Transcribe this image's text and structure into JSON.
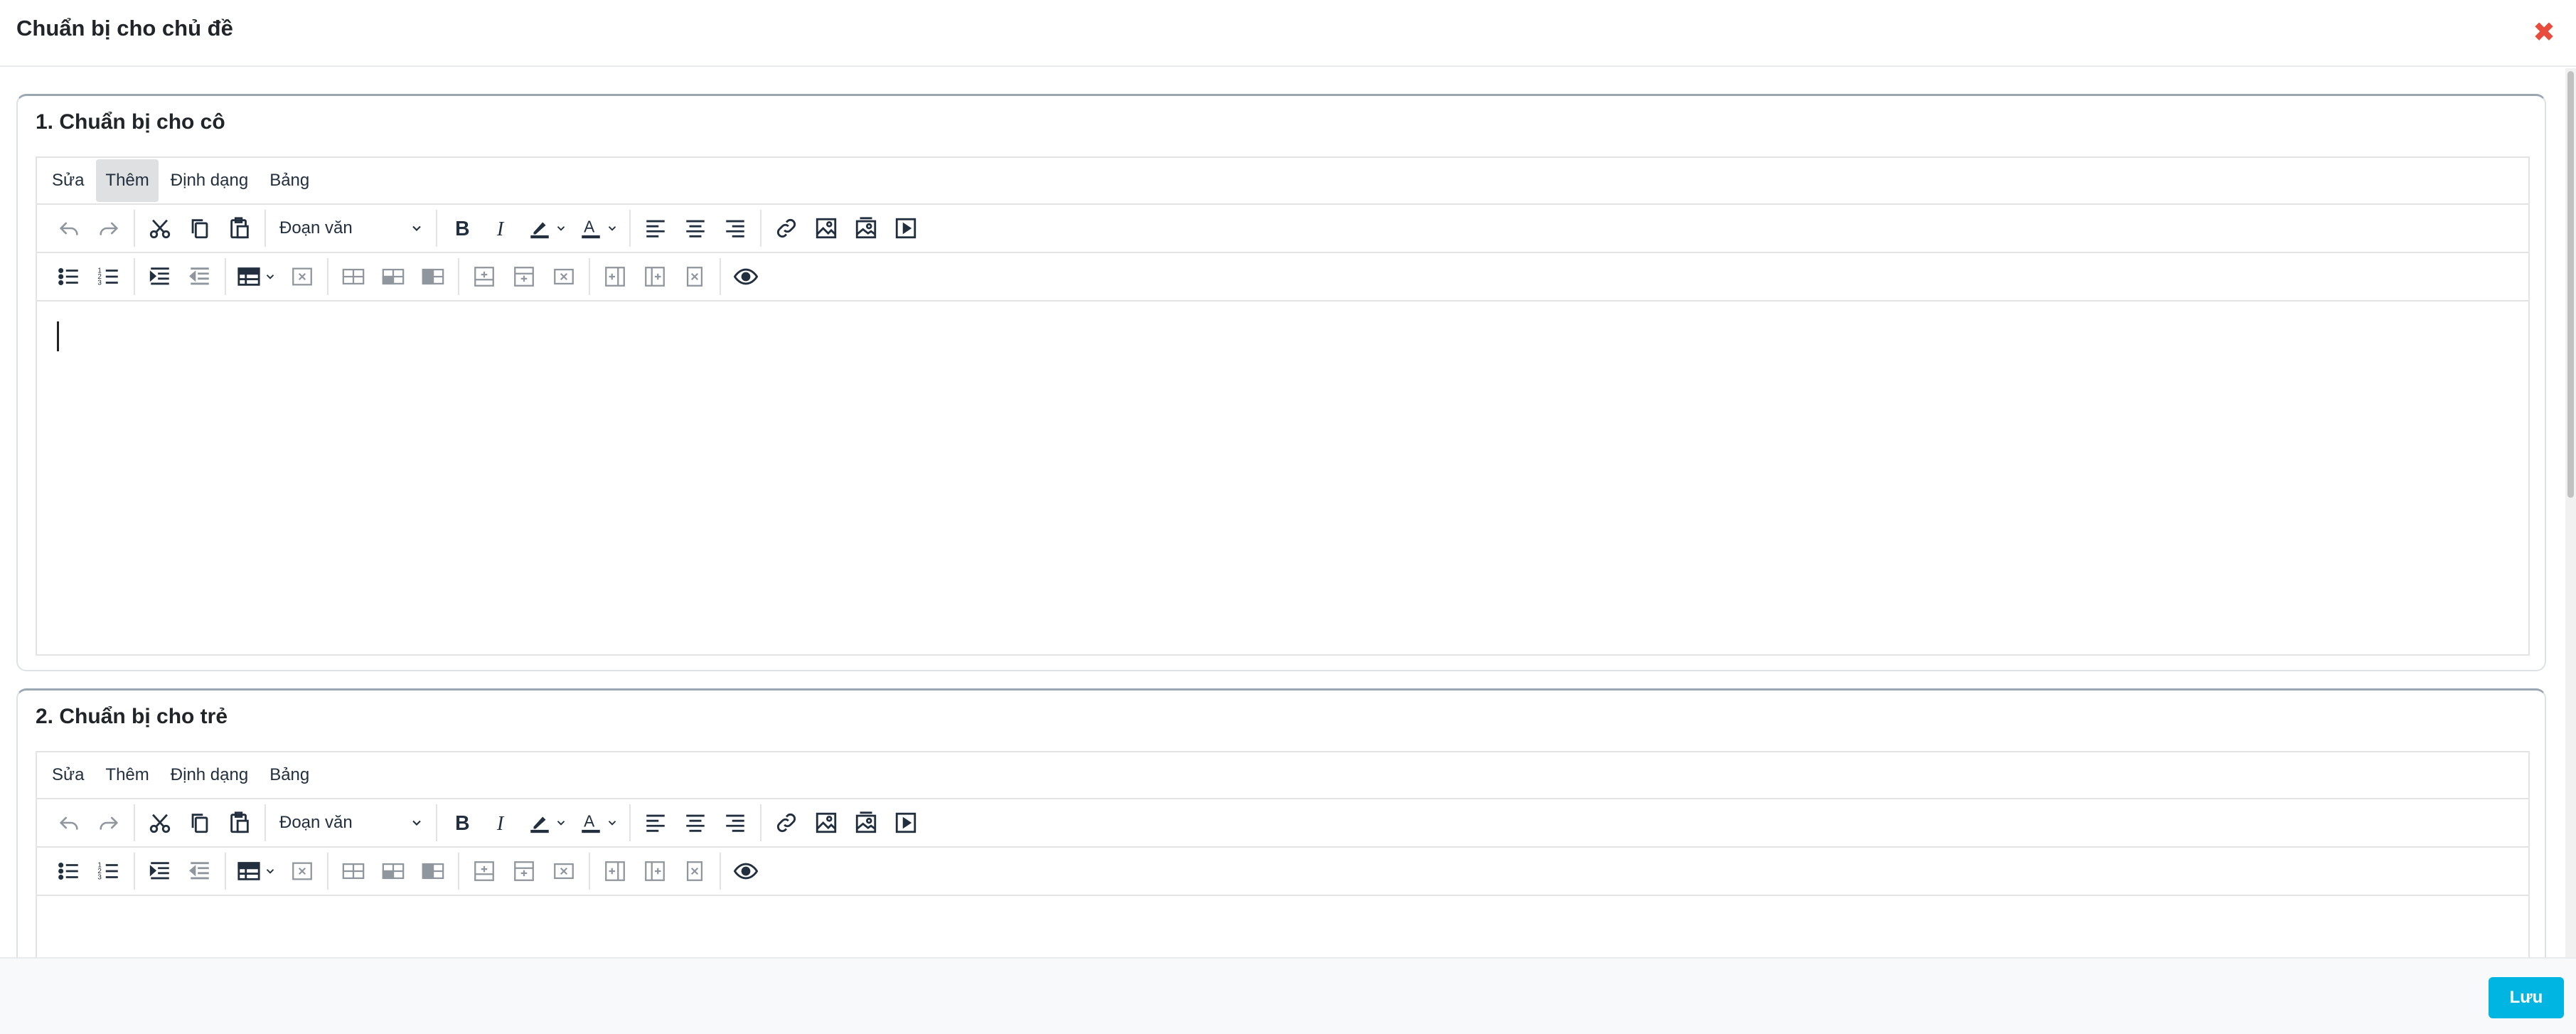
{
  "modal": {
    "title": "Chuẩn bị cho chủ đề",
    "close_icon": "close-x-icon",
    "close_color": "#e74c3c"
  },
  "sections": [
    {
      "title": "1. Chuẩn bị cho cô",
      "menubar": [
        "Sửa",
        "Thêm",
        "Định dạng",
        "Bảng"
      ],
      "active_menu": "Thêm",
      "block_format": "Đoạn văn",
      "has_cursor": true
    },
    {
      "title": "2. Chuẩn bị cho trẻ",
      "menubar": [
        "Sửa",
        "Thêm",
        "Định dạng",
        "Bảng"
      ],
      "active_menu": "",
      "block_format": "Đoạn văn",
      "has_cursor": false
    }
  ],
  "toolbar_row1_icons": [
    "undo-icon",
    "redo-icon",
    "cut-icon",
    "copy-icon",
    "paste-icon",
    "bold-icon",
    "italic-icon",
    "highlight-color-icon",
    "text-color-icon",
    "align-left-icon",
    "align-center-icon",
    "align-right-icon",
    "link-icon",
    "image-icon",
    "gallery-icon",
    "media-icon"
  ],
  "toolbar_row2_icons": [
    "bullet-list-icon",
    "numbered-list-icon",
    "indent-icon",
    "outdent-icon",
    "table-icon",
    "delete-table-icon",
    "table-row-props-icon",
    "table-cell-props-icon",
    "table-merge-icon",
    "insert-row-before-icon",
    "insert-row-after-icon",
    "delete-row-icon",
    "insert-col-before-icon",
    "insert-col-after-icon",
    "delete-col-icon",
    "preview-icon"
  ],
  "footer": {
    "save_label": "Lưu",
    "save_color": "#00b5e2"
  }
}
